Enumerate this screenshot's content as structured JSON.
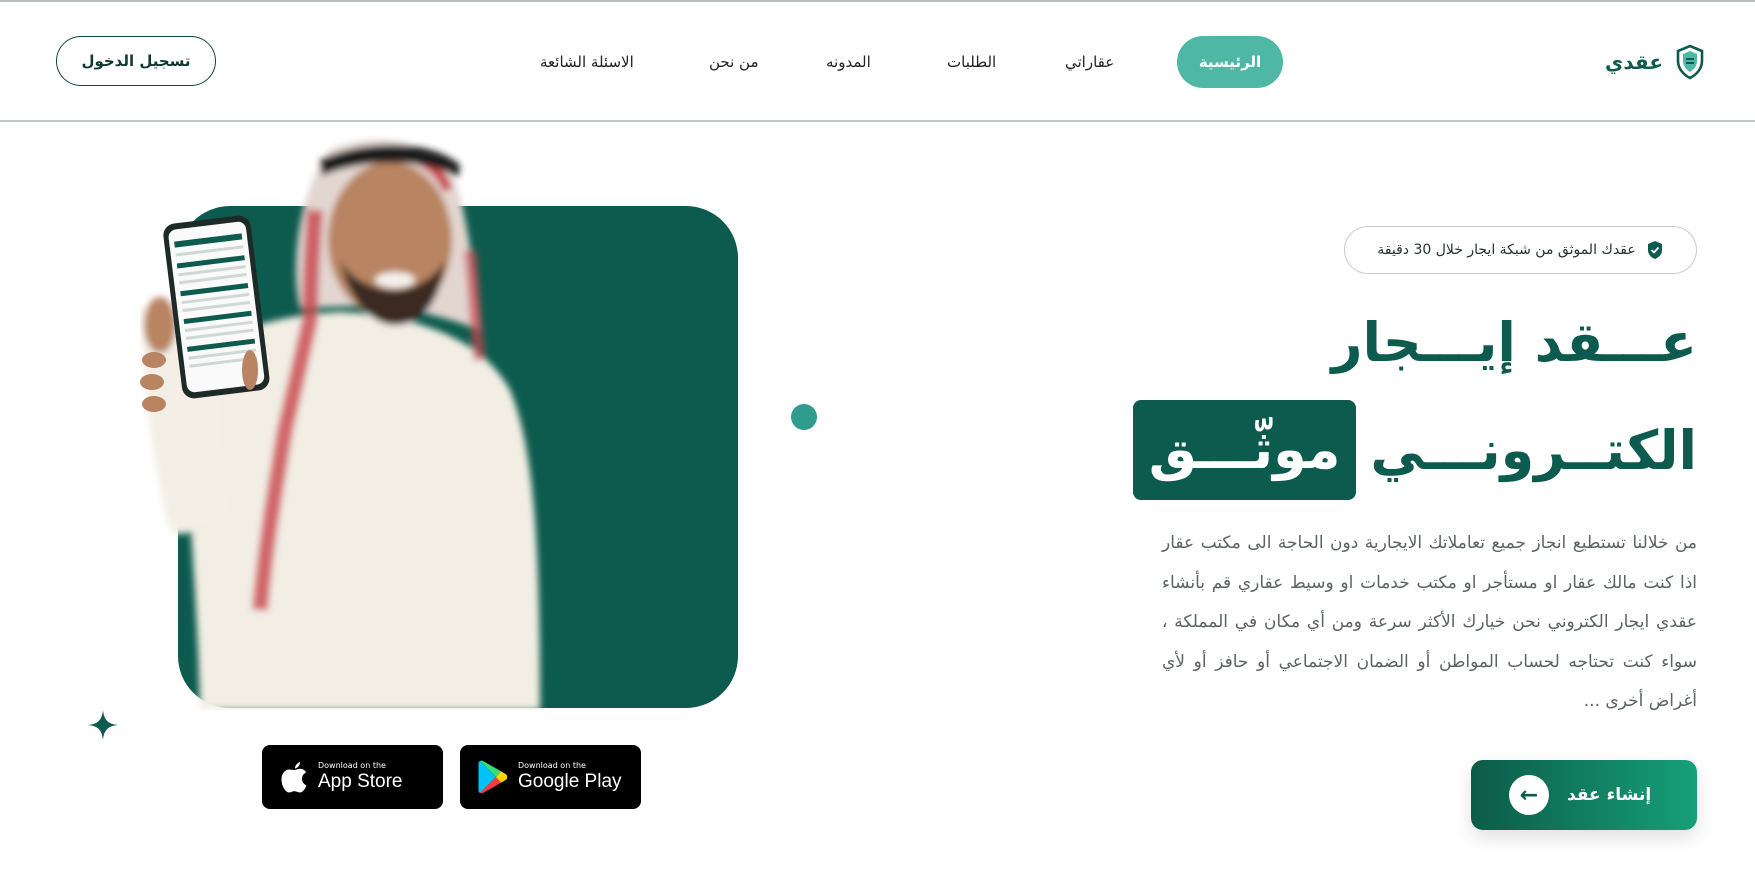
{
  "header": {
    "brand_name": "عقدي",
    "login_label": "تسجيل الدخول",
    "nav": [
      {
        "label": "الرئيسية",
        "active": true
      },
      {
        "label": "عقاراتي"
      },
      {
        "label": "الطلبات"
      },
      {
        "label": "المدونه"
      },
      {
        "label": "من نحن"
      },
      {
        "label": "الاسئلة الشائعة"
      }
    ]
  },
  "hero": {
    "badge_text": "عقدك الموثق من شبكة ايجار خلال 30 دقيقة",
    "headline_line1": "عـــقد إيـــجار",
    "headline_line2_plain": "الكتــرونـــي",
    "headline_line2_highlight": "موثّـــق",
    "description": "من خلالنا تستطيع انجاز جميع تعاملاتك الايجارية دون الحاجة الى مكتب عقار اذا كنت مالك عقار او مستأجر او مكتب خدمات او وسيط عقاري قم بأنشاء عقدي ايجار الكتروني نحن خيارك الأكثر سرعة ومن أي مكان في المملكة ، سواء كنت تحتاجه لحساب المواطن أو الضمان الاجتماعي أو حافز أو لأي أغراض أخرى ...",
    "cta_label": "إنشاء عقد"
  },
  "stores": {
    "app_store_small": "Download on the",
    "app_store_big": "App Store",
    "google_play_small": "Download on the",
    "google_play_big": "Google Play"
  },
  "colors": {
    "primary": "#0d5b4e",
    "accent": "#4fb8a5",
    "cta_gradient_end": "#16a07a"
  },
  "icons": {
    "brand": "shield-icon",
    "badge": "shield-check-icon",
    "cta": "arrow-left-icon",
    "app_store": "apple-icon",
    "google_play": "google-play-icon",
    "decor": "sparkle-icon"
  }
}
